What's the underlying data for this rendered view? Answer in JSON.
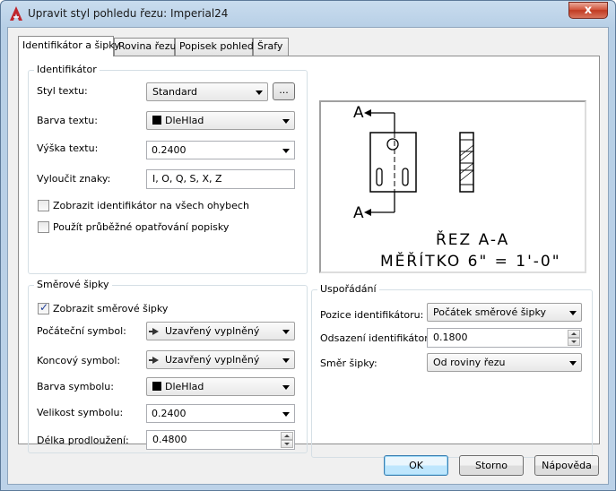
{
  "window": {
    "title": "Upravit styl pohledu řezu: Imperial24",
    "close_label": "x"
  },
  "tabs": [
    {
      "label": "Identifikátor a šipky",
      "active": true
    },
    {
      "label": "Rovina řezu",
      "active": false
    },
    {
      "label": "Popisek pohledu",
      "active": false
    },
    {
      "label": "Šrafy",
      "active": false
    }
  ],
  "identifier": {
    "group_title": "Identifikátor",
    "text_style_label": "Styl textu:",
    "text_style_value": "Standard",
    "browse_label": "...",
    "text_color_label": "Barva textu:",
    "text_color_value": "DleHlad",
    "text_height_label": "Výška textu:",
    "text_height_value": "0.2400",
    "exclude_label": "Vyloučit znaky:",
    "exclude_value": "I, O, Q, S, X, Z",
    "show_all_bends_label": "Zobrazit identifikátor na všech ohybech",
    "show_all_bends_checked": false,
    "continuous_label": "Použít průběžné opatřování popisky",
    "continuous_checked": false
  },
  "arrows": {
    "group_title": "Směrové šipky",
    "show_arrows_label": "Zobrazit směrové šipky",
    "show_arrows_checked": true,
    "start_symbol_label": "Počáteční symbol:",
    "start_symbol_value": "Uzavřený vyplněný",
    "end_symbol_label": "Koncový symbol:",
    "end_symbol_value": "Uzavřený vyplněný",
    "symbol_color_label": "Barva symbolu:",
    "symbol_color_value": "DleHlad",
    "symbol_size_label": "Velikost symbolu:",
    "symbol_size_value": "0.2400",
    "extension_length_label": "Délka prodloužení:",
    "extension_length_value": "0.4800"
  },
  "layout": {
    "group_title": "Uspořádání",
    "position_label": "Pozice identifikátoru:",
    "position_value": "Počátek směrové šipky",
    "offset_label": "Odsazení identifikátoru:",
    "offset_value": "0.1800",
    "direction_label": "Směr šipky:",
    "direction_value": "Od roviny řezu"
  },
  "preview": {
    "label_a_top": "A",
    "label_a_bottom": "A",
    "section_title": "ŘEZ A-A",
    "scale_text": "MĚŘÍTKO 6\" = 1'-0\""
  },
  "buttons": {
    "ok": "OK",
    "cancel": "Storno",
    "help": "Nápověda"
  },
  "colors": {
    "app_icon": "#c0262d",
    "checkbox_check": "#21409a",
    "default_button_border": "#3c7fb1"
  }
}
